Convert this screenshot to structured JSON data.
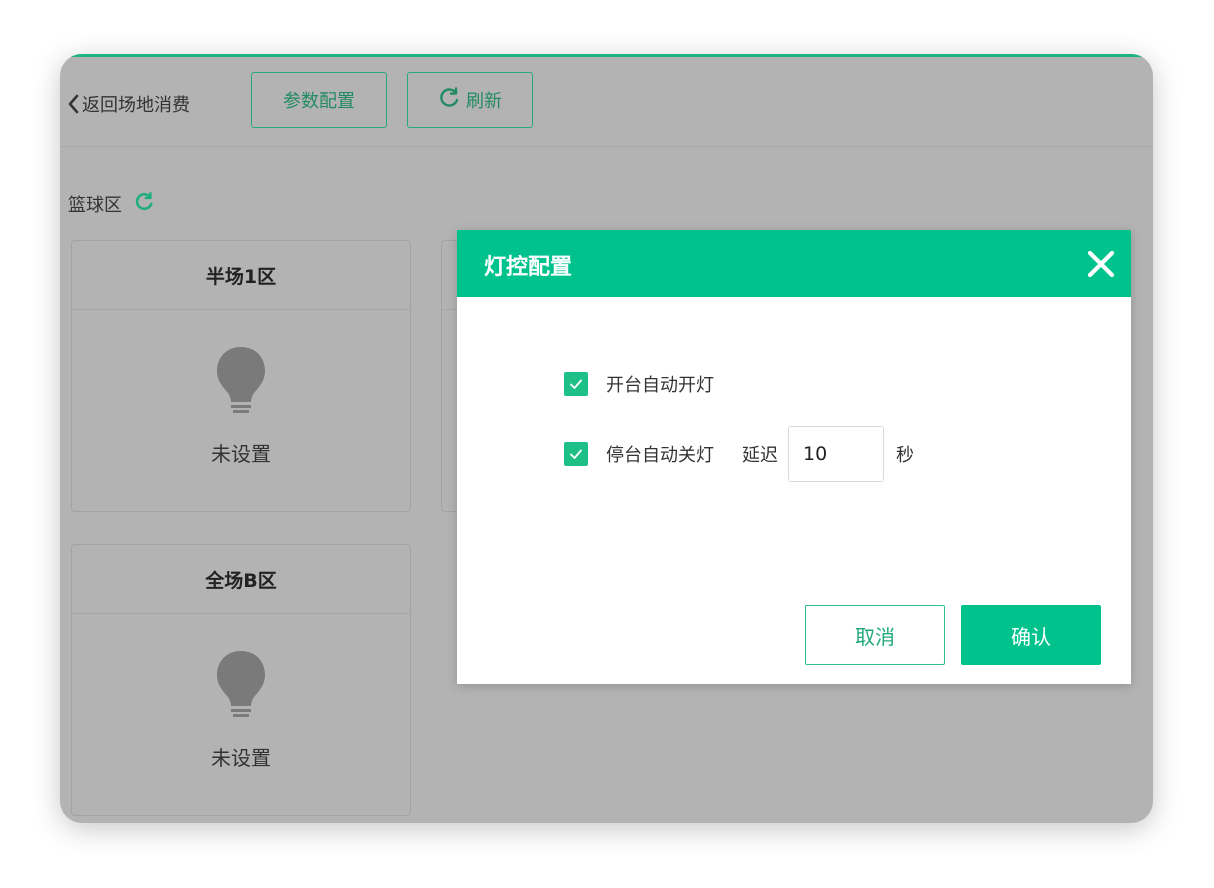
{
  "toolbar": {
    "back_label": "返回场地消费",
    "config_label": "参数配置",
    "refresh_label": "刷新"
  },
  "section": {
    "title": "篮球区"
  },
  "cards": [
    {
      "title": "半场1区",
      "status": "未设置"
    },
    {
      "title": "",
      "status": ""
    },
    {
      "title": "全场B区",
      "status": "未设置"
    }
  ],
  "modal": {
    "title": "灯控配置",
    "option1_label": "开台自动开灯",
    "option1_checked": true,
    "option2_label": "停台自动关灯",
    "option2_checked": true,
    "delay_label": "延迟",
    "delay_value": "10",
    "delay_unit": "秒",
    "cancel_label": "取消",
    "confirm_label": "确认"
  },
  "colors": {
    "accent": "#00c28c",
    "overlay": "#b3b3b3",
    "bulb": "#7a7a7a"
  },
  "icons": {
    "back": "chevron-left-icon",
    "refresh": "refresh-icon",
    "bulb": "light-bulb-icon",
    "close": "close-icon",
    "check": "check-icon"
  }
}
